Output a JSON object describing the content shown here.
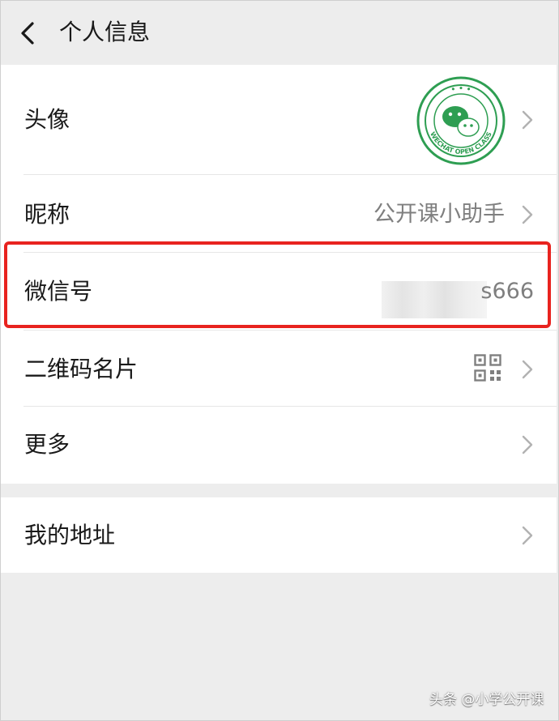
{
  "header": {
    "title": "个人信息",
    "back_icon": "chevron-left-icon"
  },
  "rows": {
    "avatar": {
      "label": "头像",
      "icon": "wechat-open-class-logo"
    },
    "nickname": {
      "label": "昵称",
      "value": "公开课小助手"
    },
    "wechat_id": {
      "label": "微信号",
      "value_visible": "s666"
    },
    "qr_card": {
      "label": "二维码名片",
      "icon": "qr-code-icon"
    },
    "more": {
      "label": "更多"
    },
    "address": {
      "label": "我的地址"
    }
  },
  "highlight_color": "#e8231f",
  "watermark": "头条 @小学公开课"
}
